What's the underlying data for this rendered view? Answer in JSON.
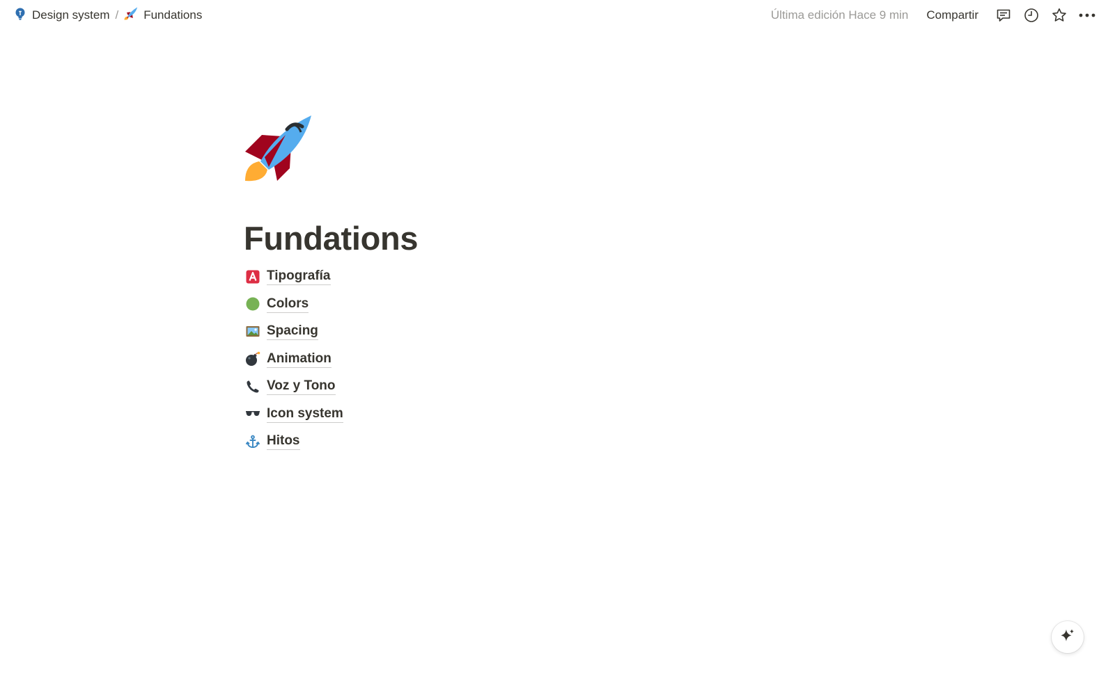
{
  "breadcrumb": {
    "workspace_label": "Design system",
    "separator": "/",
    "page_label": "Fundations"
  },
  "header": {
    "last_edited": "Última edición Hace 9 min",
    "share_label": "Compartir",
    "icons": [
      "comment-icon",
      "clock-icon",
      "star-icon",
      "more-icon"
    ]
  },
  "page": {
    "icon": "rocket-icon",
    "title": "Fundations",
    "links": [
      {
        "label": "Tipografía",
        "icon": "letter-a-icon"
      },
      {
        "label": "Colors",
        "icon": "green-circle-icon"
      },
      {
        "label": "Spacing",
        "icon": "picture-frame-icon"
      },
      {
        "label": "Animation",
        "icon": "bomb-icon"
      },
      {
        "label": "Voz y Tono",
        "icon": "phone-icon"
      },
      {
        "label": "Icon system",
        "icon": "sunglasses-icon"
      },
      {
        "label": "Hitos",
        "icon": "anchor-icon"
      }
    ]
  },
  "colors": {
    "text": "#37352f",
    "muted": "#9b9a97",
    "accent_red": "#dd2e44",
    "accent_green": "#77b255",
    "rocket_blue": "#55acee",
    "rocket_red": "#a0041e",
    "flame": "#ffac33"
  },
  "fab": {
    "icon": "sparkle-icon"
  }
}
